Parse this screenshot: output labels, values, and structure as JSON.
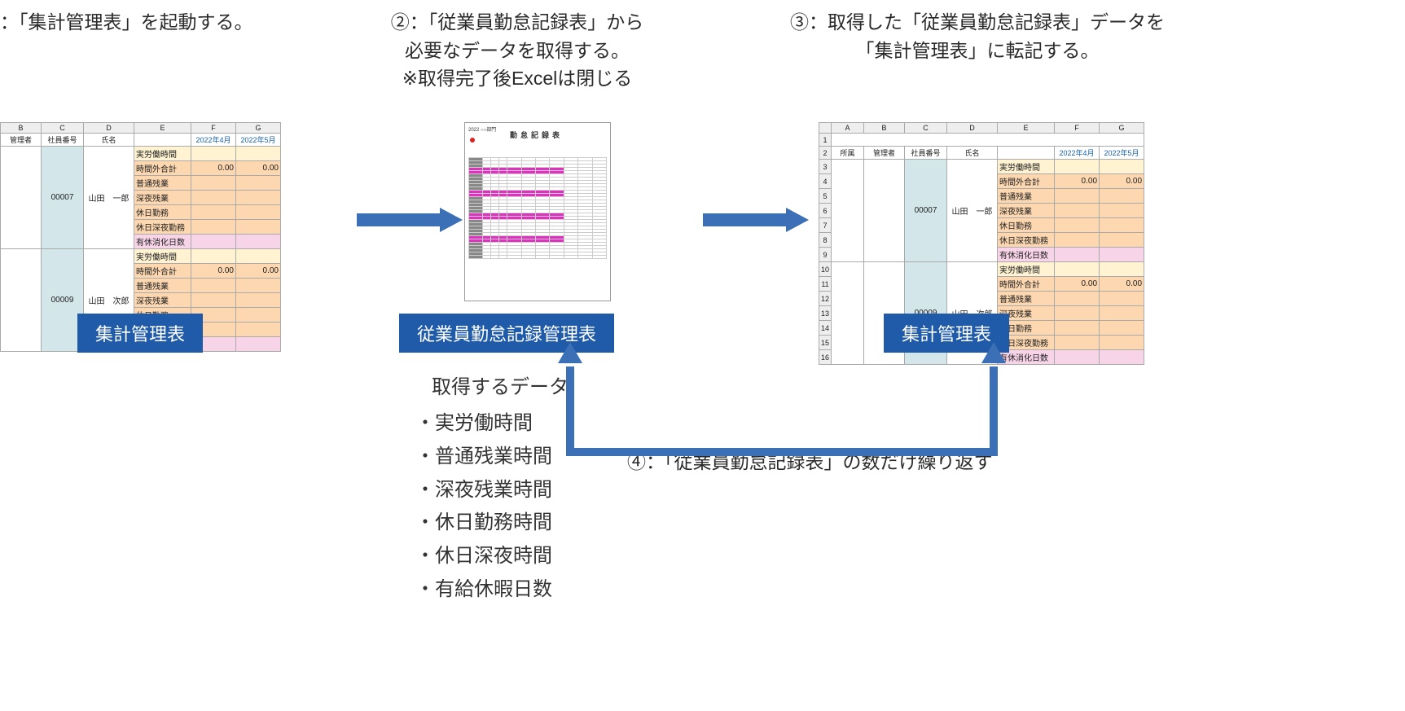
{
  "steps": {
    "s1": "：「集計管理表」を起動する。",
    "s2": "②：「従業員勤怠記録表」から\n必要なデータを取得する。\n※取得完了後Excelは閉じる",
    "s3": "③：取得した「従業員勤怠記録表」データを\n「集計管理表」に転記する。",
    "s4": "④：「従業員勤怠記録表」の数だけ繰り返す"
  },
  "labels": {
    "l1": "集計管理表",
    "l2": "従業員勤怠記録管理表",
    "l3": "集計管理表"
  },
  "data_list_title": "取得するデータ",
  "data_list": [
    "実労働時間",
    "普通残業時間",
    "深夜残業時間",
    "休日勤務時間",
    "休日深夜時間",
    "有給休暇日数"
  ],
  "excel": {
    "cols": [
      "A",
      "B",
      "C",
      "D",
      "E",
      "F",
      "G"
    ],
    "header": {
      "a": "所属",
      "b": "管理者",
      "c": "社員番号",
      "d": "氏名",
      "e": "",
      "f": "2022年4月",
      "g": "2022年5月"
    },
    "rows": {
      "r3": {
        "e": "実労働時間"
      },
      "r4": {
        "e": "時間外合計",
        "f": "0.00",
        "g": "0.00"
      },
      "r5": {
        "e": "普通残業"
      },
      "r6_c": "00007",
      "r6_d": "山田　一郎",
      "r6": {
        "e": "深夜残業"
      },
      "r7": {
        "e": "休日勤務"
      },
      "r8": {
        "e": "休日深夜勤務"
      },
      "r9": {
        "e": "有休消化日数"
      },
      "r10": {
        "e": "実労働時間"
      },
      "r11": {
        "e": "時間外合計",
        "f": "0.00",
        "g": "0.00"
      },
      "r12": {
        "e": "普通残業"
      },
      "r13_c": "00009",
      "r13_d": "山田　次郎",
      "r13": {
        "e": "深夜残業"
      },
      "r14": {
        "e": "休日勤務"
      },
      "r15": {
        "e": "休日深夜勤務"
      },
      "r16": {
        "e": "有休消化日数"
      }
    }
  },
  "att_sheet": {
    "title": "勤怠記録表"
  }
}
